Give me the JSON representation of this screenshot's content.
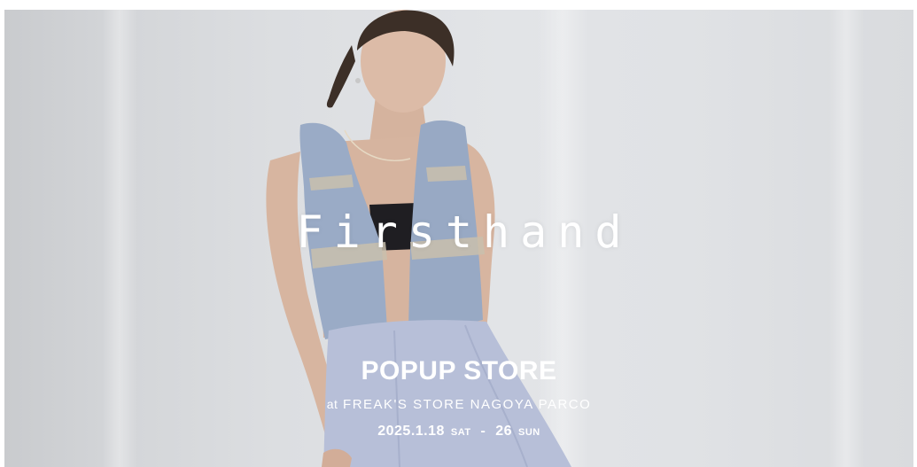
{
  "banner": {
    "brand": "Firsthand",
    "event_title": "POPUP STORE",
    "venue_prefix": "at",
    "venue_name": "FREAK'S STORE NAGOYA PARCO",
    "date_start": "2025.1.18",
    "date_start_day": "SAT",
    "date_separator": "-",
    "date_end": "26",
    "date_end_day": "SUN"
  },
  "colors": {
    "text": "#ffffff",
    "backdrop": "#dcdee1",
    "vest": "#9aabc6",
    "skirt": "#b7bfd8",
    "skin": "#d9b8a3",
    "hair": "#3c2f27"
  }
}
